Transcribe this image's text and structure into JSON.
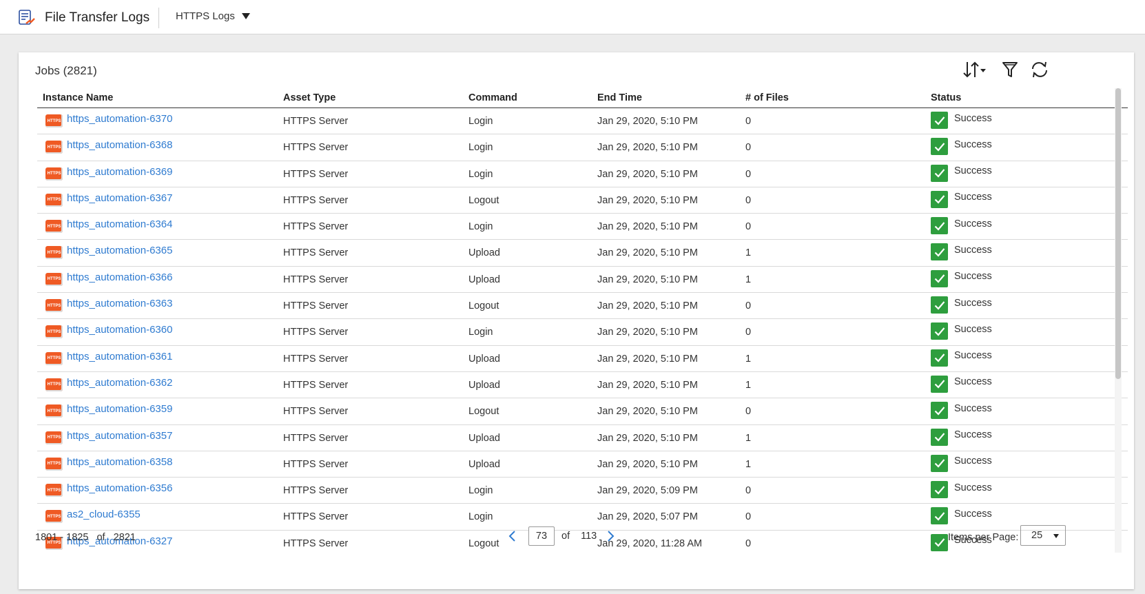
{
  "header": {
    "app_title": "File Transfer Logs",
    "logs_selector": "HTTPS Logs"
  },
  "jobs": {
    "title": "Jobs (2821)"
  },
  "table": {
    "columns": [
      "Instance Name",
      "Asset Type",
      "Command",
      "End Time",
      "# of Files",
      "Status"
    ],
    "badge_text": "HTTPS",
    "rows": [
      {
        "name": "https_automation-6370",
        "asset": "HTTPS Server",
        "command": "Login",
        "end": "Jan 29, 2020, 5:10 PM",
        "files": "0",
        "status": "Success"
      },
      {
        "name": "https_automation-6368",
        "asset": "HTTPS Server",
        "command": "Login",
        "end": "Jan 29, 2020, 5:10 PM",
        "files": "0",
        "status": "Success"
      },
      {
        "name": "https_automation-6369",
        "asset": "HTTPS Server",
        "command": "Login",
        "end": "Jan 29, 2020, 5:10 PM",
        "files": "0",
        "status": "Success"
      },
      {
        "name": "https_automation-6367",
        "asset": "HTTPS Server",
        "command": "Logout",
        "end": "Jan 29, 2020, 5:10 PM",
        "files": "0",
        "status": "Success"
      },
      {
        "name": "https_automation-6364",
        "asset": "HTTPS Server",
        "command": "Login",
        "end": "Jan 29, 2020, 5:10 PM",
        "files": "0",
        "status": "Success"
      },
      {
        "name": "https_automation-6365",
        "asset": "HTTPS Server",
        "command": "Upload",
        "end": "Jan 29, 2020, 5:10 PM",
        "files": "1",
        "status": "Success"
      },
      {
        "name": "https_automation-6366",
        "asset": "HTTPS Server",
        "command": "Upload",
        "end": "Jan 29, 2020, 5:10 PM",
        "files": "1",
        "status": "Success"
      },
      {
        "name": "https_automation-6363",
        "asset": "HTTPS Server",
        "command": "Logout",
        "end": "Jan 29, 2020, 5:10 PM",
        "files": "0",
        "status": "Success"
      },
      {
        "name": "https_automation-6360",
        "asset": "HTTPS Server",
        "command": "Login",
        "end": "Jan 29, 2020, 5:10 PM",
        "files": "0",
        "status": "Success"
      },
      {
        "name": "https_automation-6361",
        "asset": "HTTPS Server",
        "command": "Upload",
        "end": "Jan 29, 2020, 5:10 PM",
        "files": "1",
        "status": "Success"
      },
      {
        "name": "https_automation-6362",
        "asset": "HTTPS Server",
        "command": "Upload",
        "end": "Jan 29, 2020, 5:10 PM",
        "files": "1",
        "status": "Success"
      },
      {
        "name": "https_automation-6359",
        "asset": "HTTPS Server",
        "command": "Logout",
        "end": "Jan 29, 2020, 5:10 PM",
        "files": "0",
        "status": "Success"
      },
      {
        "name": "https_automation-6357",
        "asset": "HTTPS Server",
        "command": "Upload",
        "end": "Jan 29, 2020, 5:10 PM",
        "files": "1",
        "status": "Success"
      },
      {
        "name": "https_automation-6358",
        "asset": "HTTPS Server",
        "command": "Upload",
        "end": "Jan 29, 2020, 5:10 PM",
        "files": "1",
        "status": "Success"
      },
      {
        "name": "https_automation-6356",
        "asset": "HTTPS Server",
        "command": "Login",
        "end": "Jan 29, 2020, 5:09 PM",
        "files": "0",
        "status": "Success"
      },
      {
        "name": "as2_cloud-6355",
        "asset": "HTTPS Server",
        "command": "Login",
        "end": "Jan 29, 2020, 5:07 PM",
        "files": "0",
        "status": "Success"
      },
      {
        "name": "https_automation-6327",
        "asset": "HTTPS Server",
        "command": "Logout",
        "end": "Jan 29, 2020, 11:28 AM",
        "files": "0",
        "status": "Success"
      }
    ]
  },
  "footer": {
    "range": "1801 - 1825   of   2821",
    "page_value": "73",
    "of_label": "of",
    "total_pages": "113",
    "items_per_page_label": "Items per Page:",
    "items_per_page_value": "25"
  },
  "colors": {
    "link": "#2f7bd0",
    "success": "#2e9e3e",
    "https_badge": "#ef5a24"
  },
  "icons": [
    "file-transfer-logs-icon",
    "sort-icon",
    "filter-icon",
    "refresh-icon",
    "https-badge-icon",
    "success-check-icon",
    "chevron-left-icon",
    "chevron-right-icon"
  ]
}
